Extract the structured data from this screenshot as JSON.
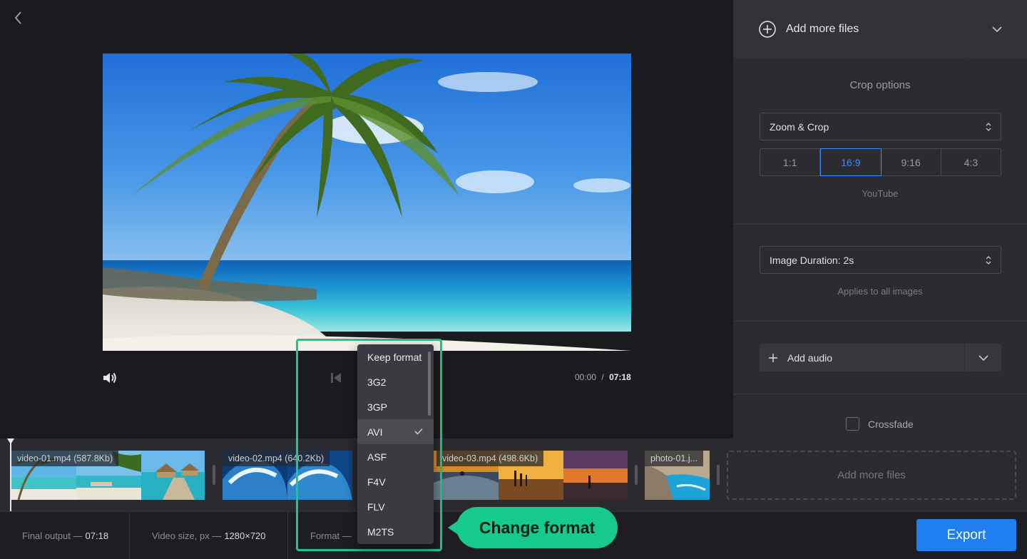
{
  "preview": {
    "time_current": "00:00",
    "time_separator": "/",
    "time_total": "07:18"
  },
  "sidebar": {
    "add_files_label": "Add more files",
    "crop_title": "Crop options",
    "crop_select_value": "Zoom & Crop",
    "ratios": [
      {
        "label": "1:1",
        "active": false
      },
      {
        "label": "16:9",
        "active": true
      },
      {
        "label": "9:16",
        "active": false
      },
      {
        "label": "4:3",
        "active": false
      }
    ],
    "ratio_hint": "YouTube",
    "duration_select_value": "Image Duration: 2s",
    "duration_hint": "Applies to all images",
    "add_audio_label": "Add audio",
    "crossfade_label": "Crossfade",
    "crossfade_checked": false
  },
  "timeline": {
    "clips": [
      {
        "label": "video-01.mp4 (587.8Kb)"
      },
      {
        "label": "video-02.mp4 (640.2Kb)"
      },
      {
        "label": "video-03.mp4 (498.6Kb)"
      },
      {
        "label": "photo-01.j..."
      }
    ],
    "add_more_label": "Add more files"
  },
  "bottom_bar": {
    "final_output_label": "Final output —",
    "final_output_value": "07:18",
    "video_size_label": "Video size, px —",
    "video_size_value": "1280×720",
    "format_label": "Format —",
    "export_label": "Export"
  },
  "format_menu": {
    "options": [
      "Keep format",
      "3G2",
      "3GP",
      "AVI",
      "ASF",
      "F4V",
      "FLV",
      "M2TS"
    ],
    "selected": "AVI"
  },
  "callout": {
    "text": "Change format"
  },
  "colors": {
    "accent_blue": "#1f7ef0",
    "ratio_active": "#3d8bff",
    "highlight_green": "#16c98d"
  }
}
